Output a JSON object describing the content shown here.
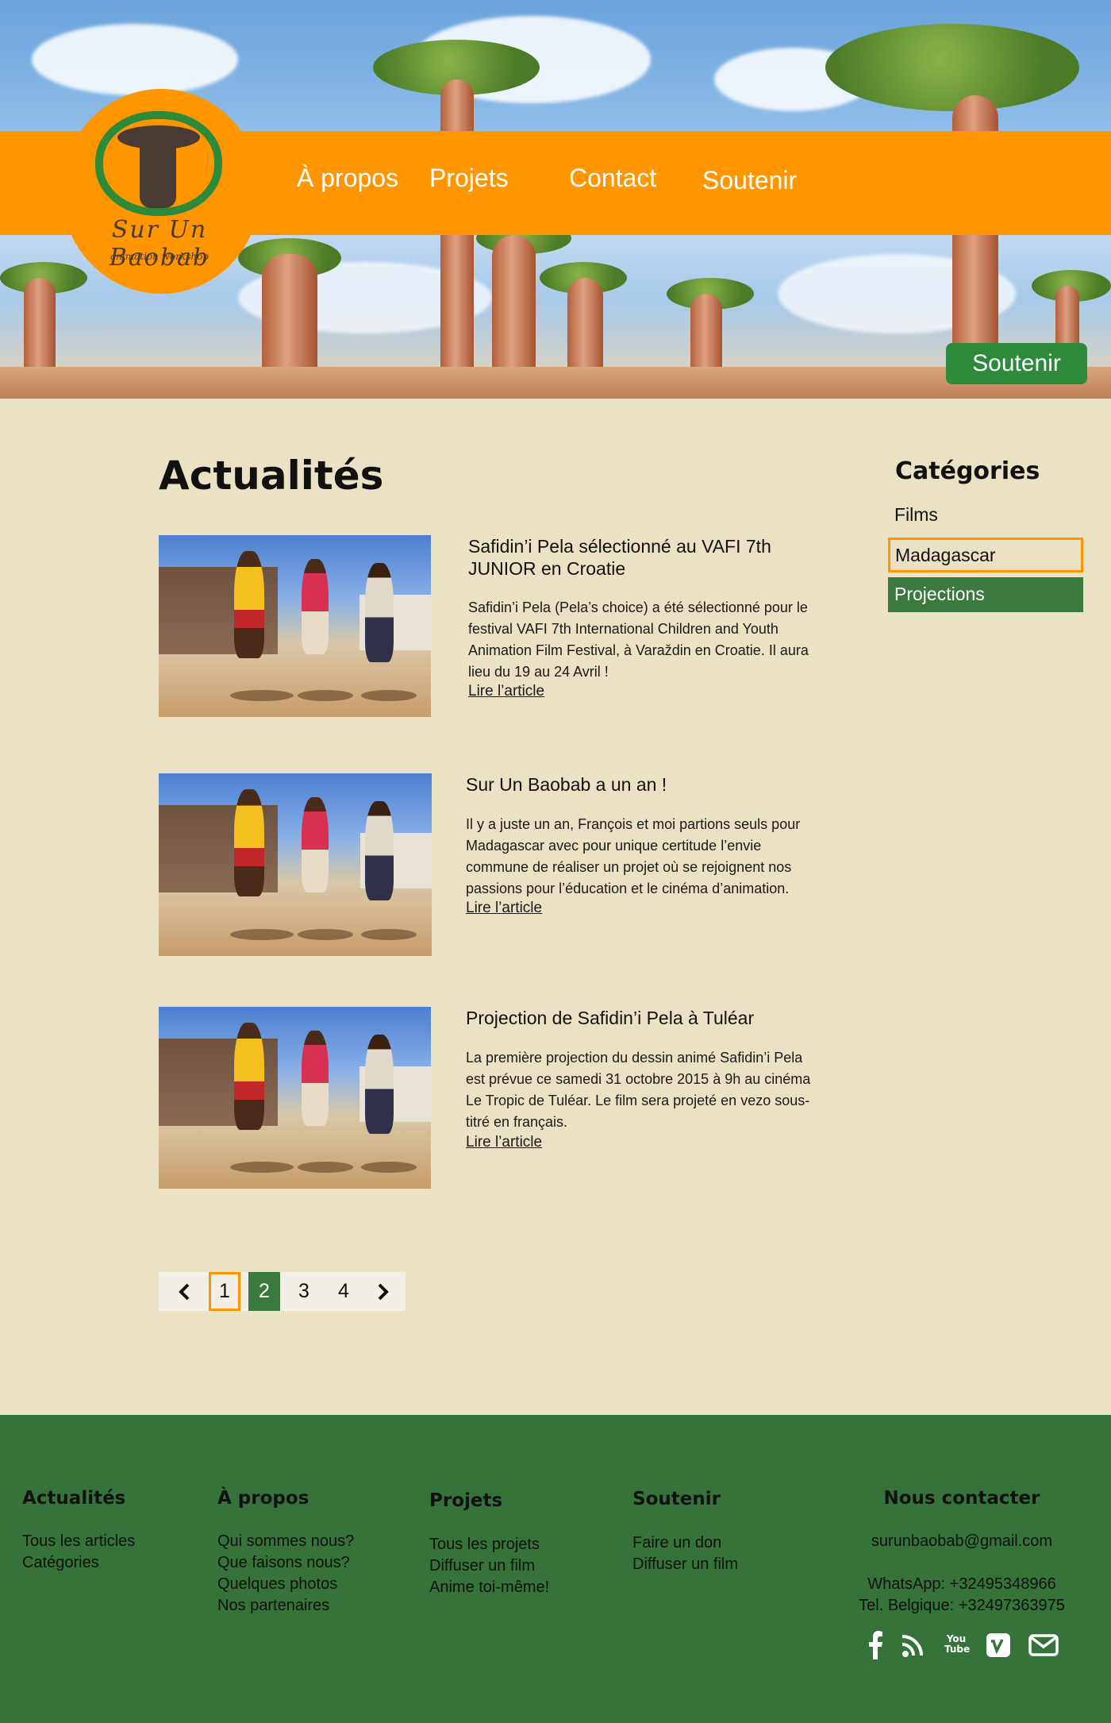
{
  "header": {
    "logo_title": "Sur Un Baobab",
    "logo_subtitle": "animation workshop",
    "nav": [
      "À propos",
      "Projets",
      "Contact",
      "Soutenir"
    ],
    "cta_label": "Soutenir"
  },
  "main": {
    "title": "Actualités",
    "articles": [
      {
        "title": "Safidin’i Pela sélectionné au VAFI 7th JUNIOR en Croatie",
        "body": "Safidin’i Pela (Pela’s choice) a été sélectionné pour le festival VAFI 7th International Children and Youth Animation Film Festival, à Varaždin en Croatie. Il aura lieu du 19 au 24 Avril !",
        "link": "Lire l’article"
      },
      {
        "title": "Sur Un Baobab a un an !",
        "body": "Il y a juste un an, François et moi partions seuls pour Madagascar avec pour unique certitude l’envie commune de réaliser un projet où se rejoignent nos passions pour l’éducation et le cinéma d’animation.",
        "link": "Lire l’article"
      },
      {
        "title": "Projection de Safidin’i Pela à Tuléar",
        "body": "La première projection du dessin animé Safidin’i Pela est prévue ce samedi 31 octobre 2015 à 9h au cinéma Le Tropic de Tuléar. Le film sera projeté en vezo sous-titré en français.",
        "link": "Lire l’article"
      }
    ],
    "pagination": {
      "prev_icon": "chevron-left-icon",
      "next_icon": "chevron-right-icon",
      "pages": [
        "1",
        "2",
        "3",
        "4"
      ],
      "current": "2"
    }
  },
  "sidebar": {
    "title": "Catégories",
    "items": [
      "Films",
      "Madagascar",
      "Projections"
    ]
  },
  "footer": {
    "col1": {
      "title": "Actualités",
      "links": [
        "Tous les articles",
        "Catégories"
      ]
    },
    "col2": {
      "title": "À propos",
      "links": [
        "Qui sommes nous?",
        "Que faisons nous?",
        "Quelques photos",
        "Nos partenaires"
      ]
    },
    "col3": {
      "title": "Projets",
      "links": [
        "Tous les projets",
        "Diffuser un film",
        "Anime toi-même!"
      ]
    },
    "col4": {
      "title": "Soutenir",
      "links": [
        "Faire un don",
        "Diffuser un film"
      ]
    },
    "contact": {
      "title": "Nous contacter",
      "email": "surunbaobab@gmail.com",
      "whatsapp": "WhatsApp: +32495348966",
      "phone": "Tel. Belgique: +32497363975",
      "youtube_label": "You Tube",
      "social_icons": [
        "facebook-icon",
        "rss-icon",
        "youtube-icon",
        "vimeo-icon",
        "mail-icon"
      ]
    }
  },
  "colors": {
    "orange": "#ff9600",
    "green": "#2c8a3a",
    "footer_green": "#36733b",
    "sidebar_active": "#3a7a3f",
    "background": "#ebe2c5"
  }
}
